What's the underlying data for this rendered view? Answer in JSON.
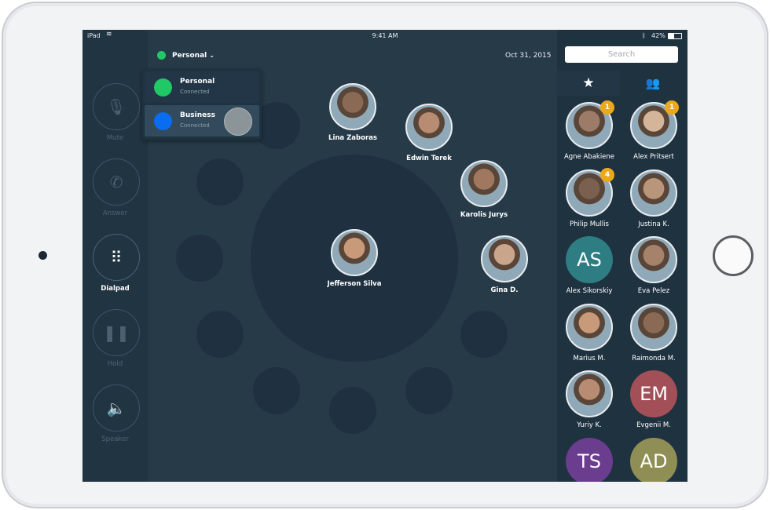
{
  "status_bar": {
    "device": "iPad",
    "time": "9:41 AM",
    "battery": "42%"
  },
  "account": {
    "selected": "Personal",
    "date": "Oct 31, 2015",
    "status_color": "#21c866",
    "menu": [
      {
        "label": "Personal",
        "status": "Connected",
        "color": "#21c866"
      },
      {
        "label": "Business",
        "status": "Connected",
        "color": "#0a6cf0",
        "selected": true
      }
    ]
  },
  "controls": [
    {
      "label": "Mute",
      "icon": "mic-off-icon",
      "active": false
    },
    {
      "label": "Answer",
      "icon": "phone-icon",
      "active": false
    },
    {
      "label": "Dialpad",
      "icon": "dialpad-icon",
      "active": true
    },
    {
      "label": "Hold",
      "icon": "pause-icon",
      "active": false
    },
    {
      "label": "Speaker",
      "icon": "speaker-icon",
      "active": false
    }
  ],
  "center_contact": {
    "name": "Jefferson Silva"
  },
  "ring_contacts": [
    {
      "name": "Lina Zaboras"
    },
    {
      "name": "Edwin Terek"
    },
    {
      "name": "Karolis Jurys"
    },
    {
      "name": "Gina D."
    }
  ],
  "search": {
    "placeholder": "Search"
  },
  "tabs": [
    {
      "icon": "star-icon",
      "name": "favorites"
    },
    {
      "icon": "contacts-icon",
      "name": "contacts"
    }
  ],
  "favorites": [
    {
      "name": "Agne Abakiene",
      "badge": "1"
    },
    {
      "name": "Alex Pritsert",
      "badge": "1"
    },
    {
      "name": "Philip Mullis",
      "badge": "4"
    },
    {
      "name": "Justina K."
    },
    {
      "name": "Alex Sikorskiy",
      "initials": "AS",
      "color": "#2e7d83"
    },
    {
      "name": "Eva Pelez"
    },
    {
      "name": "Marius M."
    },
    {
      "name": "Raimonda M."
    },
    {
      "name": "Yuriy K."
    },
    {
      "name": "Evgenii M.",
      "initials": "EM",
      "color": "#a34f57"
    },
    {
      "name": "",
      "initials": "TS",
      "color": "#6a3d8f"
    },
    {
      "name": "",
      "initials": "AD",
      "color": "#8f8e54"
    }
  ],
  "colors": {
    "badge": "#e9a91b",
    "background": "#263a48"
  }
}
